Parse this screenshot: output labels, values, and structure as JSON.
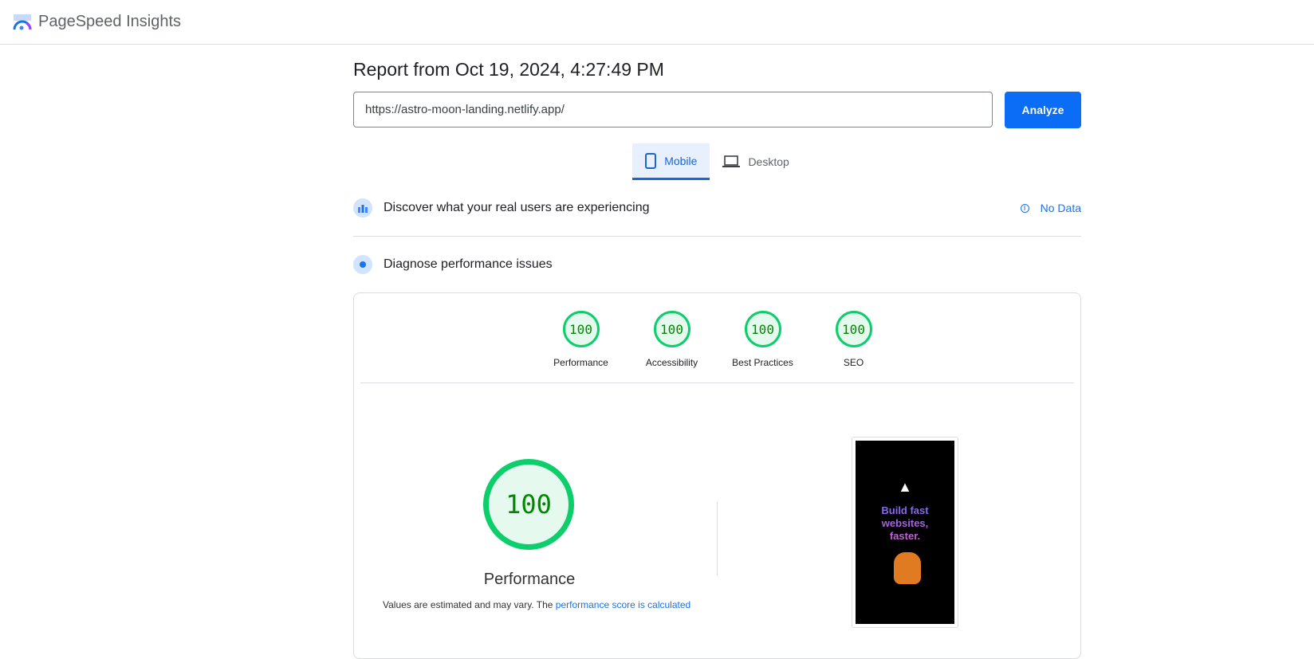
{
  "app": {
    "title": "PageSpeed Insights"
  },
  "report": {
    "title": "Report from Oct 19, 2024, 4:27:49 PM",
    "url": "https://astro-moon-landing.netlify.app/",
    "analyze_label": "Analyze"
  },
  "tabs": [
    {
      "label": "Mobile",
      "active": true
    },
    {
      "label": "Desktop",
      "active": false
    }
  ],
  "field": {
    "title": "Discover what your real users are experiencing",
    "status": "No Data"
  },
  "lab": {
    "title": "Diagnose performance issues"
  },
  "scores": [
    {
      "label": "Performance",
      "value": "100"
    },
    {
      "label": "Accessibility",
      "value": "100"
    },
    {
      "label": "Best Practices",
      "value": "100"
    },
    {
      "label": "SEO",
      "value": "100"
    }
  ],
  "performance": {
    "value": "100",
    "label": "Performance",
    "note": "Values are estimated and may vary. The ",
    "note_link": "performance score is calculated"
  },
  "screenshot": {
    "headline": "Build fast websites, faster."
  },
  "colors": {
    "accent": "#1a73e8",
    "pass": "#0cce6b"
  }
}
